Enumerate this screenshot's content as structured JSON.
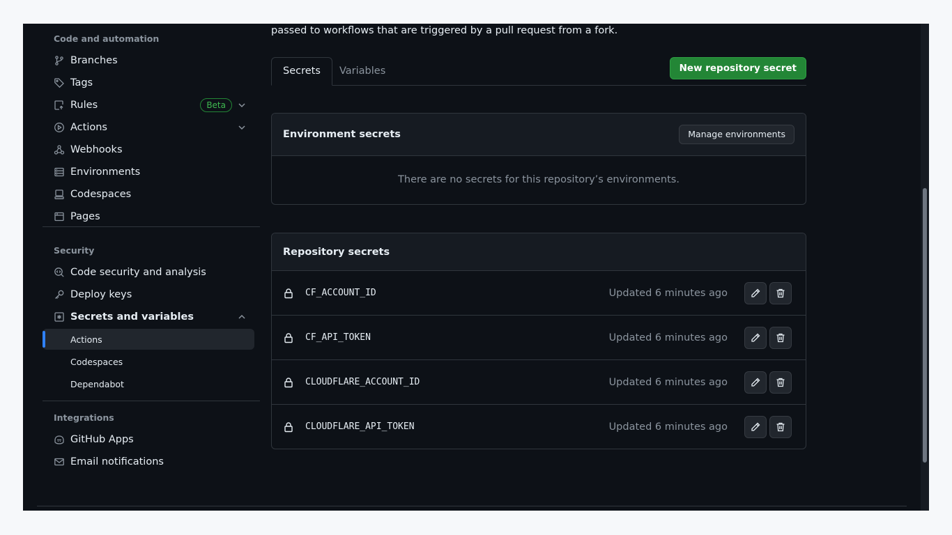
{
  "sidebar": {
    "code_section": "Code and automation",
    "code_items": [
      {
        "label": "Branches",
        "icon": "git-branch-icon"
      },
      {
        "label": "Tags",
        "icon": "tag-icon"
      },
      {
        "label": "Rules",
        "icon": "rules-icon",
        "badge": "Beta"
      },
      {
        "label": "Actions",
        "icon": "play-icon"
      },
      {
        "label": "Webhooks",
        "icon": "webhook-icon"
      },
      {
        "label": "Environments",
        "icon": "server-icon"
      },
      {
        "label": "Codespaces",
        "icon": "codespaces-icon"
      },
      {
        "label": "Pages",
        "icon": "browser-icon"
      }
    ],
    "security_section": "Security",
    "security_items": [
      {
        "label": "Code security and analysis",
        "icon": "codescan-icon"
      },
      {
        "label": "Deploy keys",
        "icon": "key-icon"
      },
      {
        "label": "Secrets and variables",
        "icon": "asterisk-icon"
      }
    ],
    "secrets_sub": [
      "Actions",
      "Codespaces",
      "Dependabot"
    ],
    "integrations_section": "Integrations",
    "integration_items": [
      {
        "label": "GitHub Apps",
        "icon": "copilot-icon"
      },
      {
        "label": "Email notifications",
        "icon": "mail-icon"
      }
    ]
  },
  "main": {
    "intro": "passed to workflows that are triggered by a pull request from a fork.",
    "tabs": [
      "Secrets",
      "Variables"
    ],
    "new_secret_label": "New repository secret",
    "env": {
      "title": "Environment secrets",
      "manage_label": "Manage environments",
      "empty": "There are no secrets for this repository’s environments."
    },
    "repo": {
      "title": "Repository secrets",
      "secrets": [
        {
          "name": "CF_ACCOUNT_ID",
          "updated": "Updated 6 minutes ago"
        },
        {
          "name": "CF_API_TOKEN",
          "updated": "Updated 6 minutes ago"
        },
        {
          "name": "CLOUDFLARE_ACCOUNT_ID",
          "updated": "Updated 6 minutes ago"
        },
        {
          "name": "CLOUDFLARE_API_TOKEN",
          "updated": "Updated 6 minutes ago"
        }
      ]
    }
  },
  "colors": {
    "accent": "#2f81f7",
    "primary_button": "#238636",
    "badge": "#3fb950"
  }
}
